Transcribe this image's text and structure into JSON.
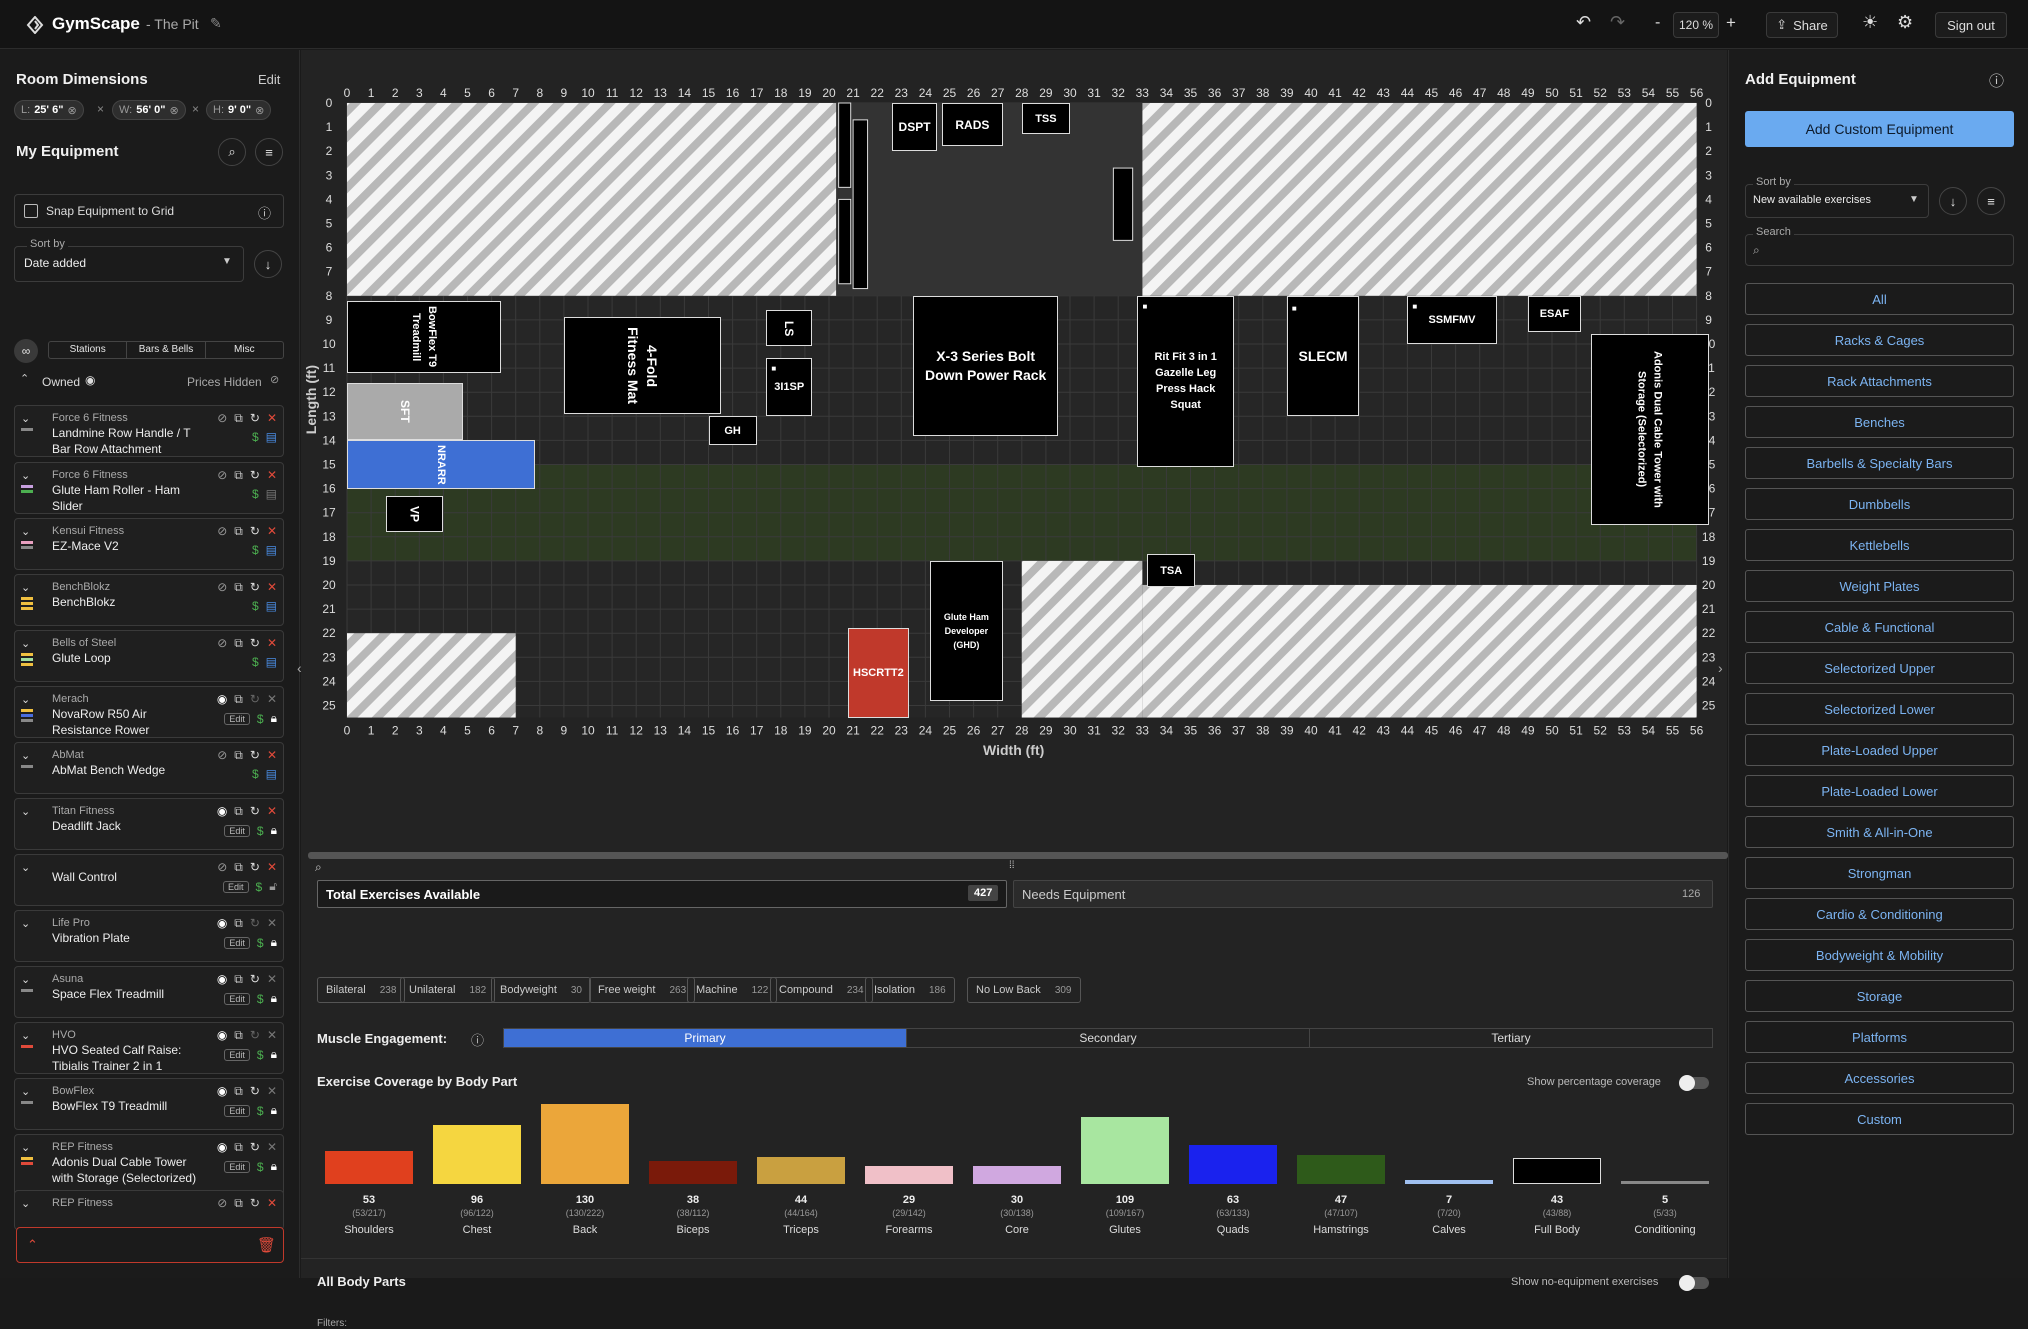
{
  "app": {
    "name": "GymScape",
    "project": "- The Pit"
  },
  "toolbar": {
    "zoom": "120 %",
    "share": "Share",
    "signout": "Sign out",
    "zoom_minus": "-",
    "zoom_plus": "+"
  },
  "room": {
    "title": "Room Dimensions",
    "edit": "Edit",
    "L": "25' 6\"",
    "W": "56' 0\"",
    "H": "9' 0\"",
    "L_label": "L:",
    "W_label": "W:",
    "H_label": "H:",
    "sep": "×"
  },
  "my_equipment": {
    "title": "My Equipment",
    "snap": "Snap Equipment to Grid",
    "sort_label": "Sort by",
    "sort_value": "Date added",
    "tabs": [
      "Stations",
      "Bars & Bells",
      "Misc"
    ],
    "owned": "Owned",
    "prices_hidden": "Prices Hidden",
    "items": [
      {
        "brand": "Force 6 Fitness",
        "name": "Landmine Row Handle / T Bar Row Attachment",
        "colors": [
          "#888"
        ],
        "locked": false
      },
      {
        "brand": "Force 6 Fitness",
        "name": "Glute Ham Roller - Ham Slider",
        "colors": [
          "#c8a0e0",
          "#4caf50"
        ],
        "locked": false
      },
      {
        "brand": "Kensui Fitness",
        "name": "EZ-Mace V2",
        "colors": [
          "#e8a0c0",
          "#888"
        ],
        "locked": false
      },
      {
        "brand": "BenchBlokz",
        "name": "BenchBlokz",
        "colors": [
          "#f0c040",
          "#f0c040",
          "#f0c040"
        ],
        "locked": false
      },
      {
        "brand": "Bells of Steel",
        "name": "Glute Loop",
        "colors": [
          "#f0c040",
          "#a0e0a0",
          "#f0c040"
        ],
        "locked": false
      },
      {
        "brand": "Merach",
        "name": "NovaRow R50 Air Resistance Rower",
        "colors": [
          "#f0c040",
          "#4a6ee0",
          "#888"
        ],
        "locked": true
      },
      {
        "brand": "AbMat",
        "name": "AbMat Bench Wedge",
        "colors": [
          "#888"
        ],
        "locked": false
      },
      {
        "brand": "Titan Fitness",
        "name": "Deadlift Jack",
        "colors": [],
        "locked": true
      },
      {
        "brand": "",
        "name": "Wall Control",
        "colors": [],
        "locked": false
      },
      {
        "brand": "Life Pro",
        "name": "Vibration Plate",
        "colors": [],
        "locked": true
      },
      {
        "brand": "Asuna",
        "name": "Space Flex Treadmill",
        "colors": [
          "#888"
        ],
        "locked": true
      },
      {
        "brand": "HVO",
        "name": "HVO Seated Calf Raise: Tibialis Trainer 2 in 1",
        "colors": [
          "#e04a3a"
        ],
        "locked": true
      },
      {
        "brand": "BowFlex",
        "name": "BowFlex T9 Treadmill",
        "colors": [
          "#888"
        ],
        "locked": true
      },
      {
        "brand": "REP Fitness",
        "name": "Adonis Dual Cable Tower with Storage (Selectorized)",
        "colors": [
          "#f0c040",
          "#e04a3a"
        ],
        "locked": true
      },
      {
        "brand": "REP Fitness",
        "name": "",
        "colors": [],
        "locked": false
      }
    ]
  },
  "canvas": {
    "x_label": "Width (ft)",
    "y_label": "Length (ft)",
    "equipment": [
      {
        "label": "DSPT"
      },
      {
        "label": "RADS"
      },
      {
        "label": "TSS"
      },
      {
        "label": "X-3 Series Bolt Down Power Rack"
      },
      {
        "label": "Rit Fit 3 in 1 Gazelle Leg Press Hack Squat"
      },
      {
        "label": "SLECM"
      },
      {
        "label": "SSMFMV"
      },
      {
        "label": "ESAF"
      },
      {
        "label": "Adonis Dual Cable Tower with Storage (Selectorized)"
      },
      {
        "label": "BowFlex T9 Treadmill"
      },
      {
        "label": "4-Fold Fitness Mat"
      },
      {
        "label": "LS"
      },
      {
        "label": "3I1SP"
      },
      {
        "label": "GH"
      },
      {
        "label": "SFT"
      },
      {
        "label": "NRARR"
      },
      {
        "label": "VP"
      },
      {
        "label": "TSA"
      },
      {
        "label": "Glute Ham Developer (GHD)"
      },
      {
        "label": "HSCRTT2"
      }
    ]
  },
  "bottom": {
    "total_label": "Total Exercises Available",
    "total_value": "427",
    "needs_label": "Needs Equipment",
    "needs_value": "126",
    "chips": [
      {
        "label": "Bilateral",
        "value": "238"
      },
      {
        "label": "Unilateral",
        "value": "182"
      },
      {
        "label": "Bodyweight",
        "value": "30"
      },
      {
        "label": "Free weight",
        "value": "263"
      },
      {
        "label": "Machine",
        "value": "122"
      },
      {
        "label": "Compound",
        "value": "234"
      },
      {
        "label": "Isolation",
        "value": "186"
      },
      {
        "label": "No Low Back",
        "value": "309"
      }
    ],
    "muscle_label": "Muscle Engagement:",
    "engagement_tabs": [
      "Primary",
      "Secondary",
      "Tertiary"
    ],
    "coverage_title": "Exercise Coverage by Body Part",
    "show_pct": "Show percentage coverage",
    "all_parts": "All Body Parts",
    "show_noeq": "Show no-equipment exercises",
    "filters": "Filters:"
  },
  "chart_data": {
    "type": "bar",
    "title": "Exercise Coverage by Body Part",
    "categories": [
      "Shoulders",
      "Chest",
      "Back",
      "Biceps",
      "Triceps",
      "Forearms",
      "Core",
      "Glutes",
      "Quads",
      "Hamstrings",
      "Calves",
      "Full Body",
      "Conditioning"
    ],
    "values": [
      53,
      96,
      130,
      38,
      44,
      29,
      30,
      109,
      63,
      47,
      7,
      43,
      5
    ],
    "sub": [
      "(53/217)",
      "(96/122)",
      "(130/222)",
      "(38/112)",
      "(44/164)",
      "(29/142)",
      "(30/138)",
      "(109/167)",
      "(63/133)",
      "(47/107)",
      "(7/20)",
      "(43/88)",
      "(5/33)"
    ],
    "colors": [
      "#e0401e",
      "#f5d640",
      "#eba63a",
      "#7a1a0a",
      "#c9a040",
      "#f0c0c8",
      "#d0a8e0",
      "#a8e6a0",
      "#1a22ee",
      "#2e5a1a",
      "#a0c0f0",
      "#000000",
      "#888888"
    ]
  },
  "add_equipment": {
    "title": "Add Equipment",
    "custom_btn": "Add Custom Equipment",
    "sort_label": "Sort by",
    "sort_value": "New available exercises",
    "search_label": "Search",
    "categories": [
      "All",
      "Racks & Cages",
      "Rack Attachments",
      "Benches",
      "Barbells & Specialty Bars",
      "Dumbbells",
      "Kettlebells",
      "Weight Plates",
      "Cable & Functional",
      "Selectorized Upper",
      "Selectorized Lower",
      "Plate-Loaded Upper",
      "Plate-Loaded Lower",
      "Smith & All-in-One",
      "Strongman",
      "Cardio & Conditioning",
      "Bodyweight & Mobility",
      "Storage",
      "Platforms",
      "Accessories",
      "Custom"
    ]
  }
}
